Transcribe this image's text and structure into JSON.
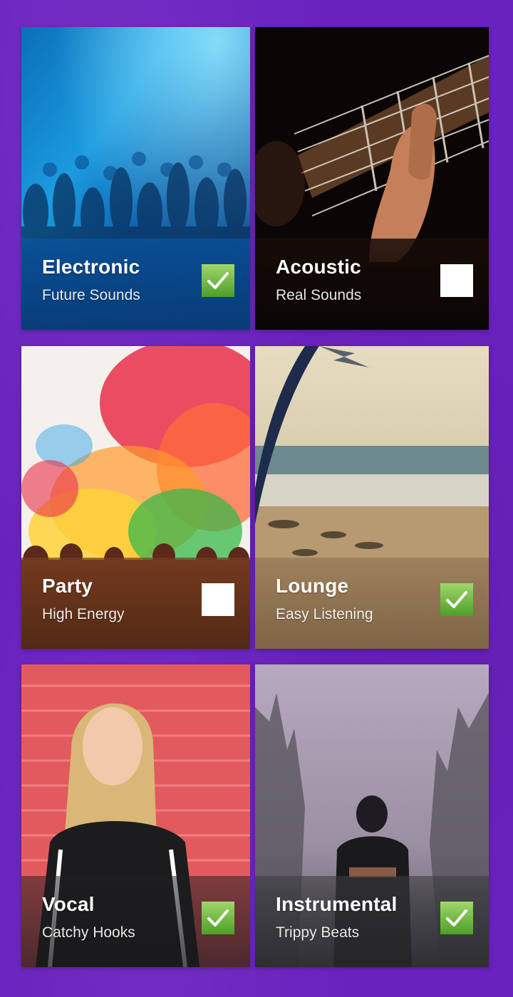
{
  "colors": {
    "background": "#6a22bf",
    "checked_green": "#6fbf3a",
    "unchecked_white": "#ffffff"
  },
  "genres": [
    {
      "title": "Electronic",
      "subtitle": "Future Sounds",
      "selected": true,
      "photo": "concert-crowd-blue-lights"
    },
    {
      "title": "Acoustic",
      "subtitle": "Real Sounds",
      "selected": false,
      "photo": "hand-on-guitar-fretboard"
    },
    {
      "title": "Party",
      "subtitle": "High Energy",
      "selected": false,
      "photo": "colorful-powder-festival"
    },
    {
      "title": "Lounge",
      "subtitle": "Easy Listening",
      "selected": true,
      "photo": "palm-tree-beach"
    },
    {
      "title": "Vocal",
      "subtitle": "Catchy Hooks",
      "selected": true,
      "photo": "woman-against-red-brick-wall"
    },
    {
      "title": "Instrumental",
      "subtitle": "Trippy Beats",
      "selected": true,
      "photo": "person-in-foggy-forest"
    }
  ]
}
